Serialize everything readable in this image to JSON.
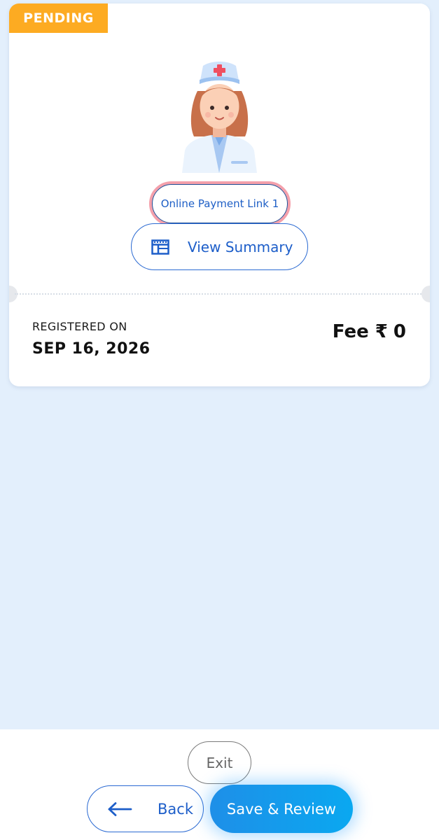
{
  "card": {
    "status": "PENDING",
    "payment_link_label": "Online Payment Link 1",
    "summary_button_label": "View Summary",
    "registered_label": "REGISTERED ON",
    "registered_date": "SEP 16, 2026",
    "fee_label": "Fee ₹",
    "fee_value": "0"
  },
  "icons": {
    "avatar": "nurse-avatar",
    "summary": "table-icon",
    "back": "arrow-left-icon"
  },
  "footer": {
    "exit_label": "Exit",
    "back_label": "Back",
    "save_label": "Save & Review"
  },
  "colors": {
    "background": "#e3effc",
    "status_badge": "#fdab22",
    "accent_blue": "#2b6ad2",
    "save_gradient_start": "#1e8fe8",
    "save_gradient_end": "#0aa8f0",
    "link_outline": "#f4a0ab"
  }
}
